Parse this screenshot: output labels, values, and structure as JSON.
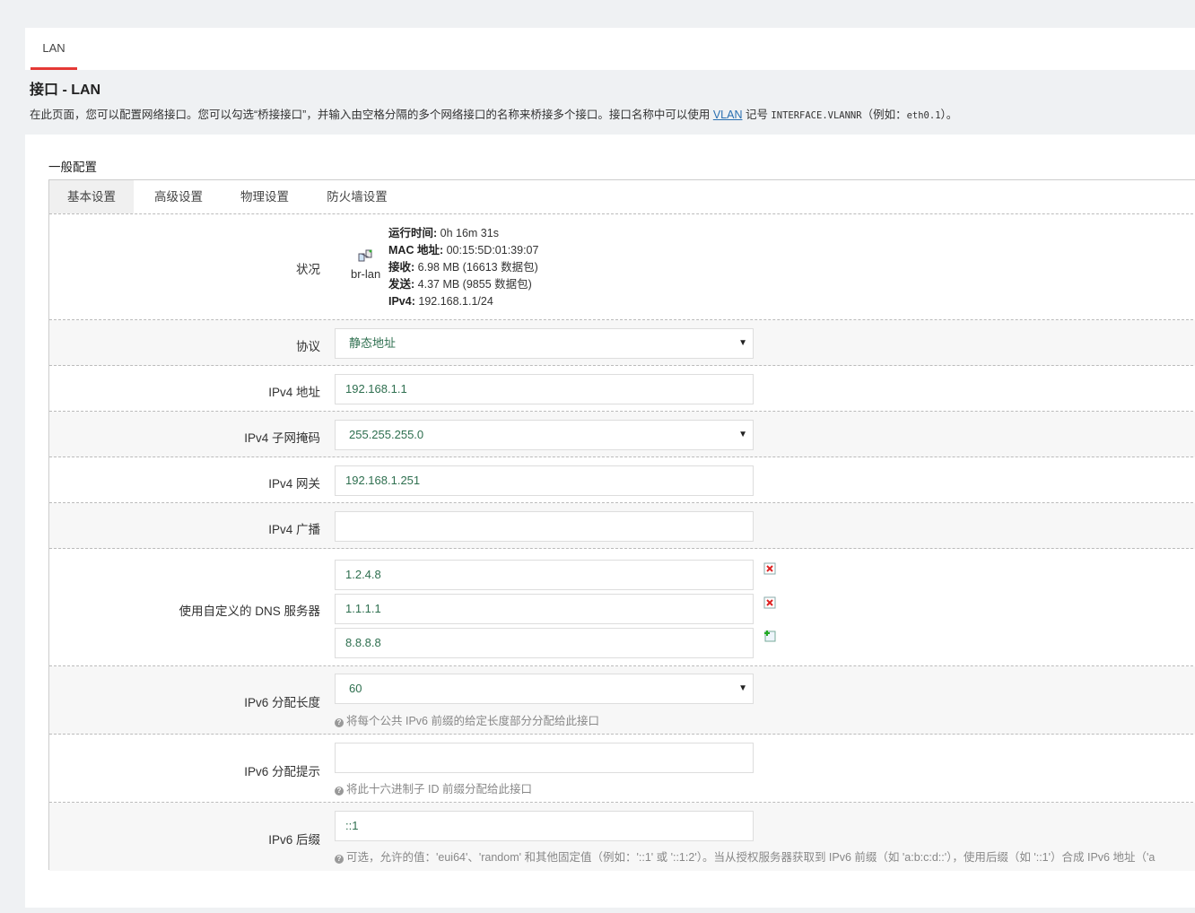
{
  "tab": {
    "label": "LAN"
  },
  "header": {
    "title": "接口 - LAN",
    "desc_before": "在此页面，您可以配置网络接口。您可以勾选“桥接接口”，并输入由空格分隔的多个网络接口的名称来桥接多个接口。接口名称中可以使用 ",
    "desc_link": "VLAN",
    "desc_mid": " 记号 ",
    "desc_code1": "INTERFACE.VLANNR",
    "desc_mid2": "（例如：",
    "desc_code2": "eth0.1",
    "desc_end": "）。"
  },
  "section": {
    "title": "一般配置"
  },
  "subtabs": [
    "基本设置",
    "高级设置",
    "物理设置",
    "防火墙设置"
  ],
  "status": {
    "label": "状况",
    "device": "br-lan",
    "uptime_key": "运行时间:",
    "uptime_val": " 0h 16m 31s",
    "mac_key": "MAC 地址:",
    "mac_val": " 00:15:5D:01:39:07",
    "rx_key": "接收:",
    "rx_val": " 6.98 MB (16613 数据包)",
    "tx_key": "发送:",
    "tx_val": " 4.37 MB (9855 数据包)",
    "ipv4_key": "IPv4:",
    "ipv4_val": " 192.168.1.1/24"
  },
  "protocol": {
    "label": "协议",
    "value": "静态地址"
  },
  "ipv4_addr": {
    "label": "IPv4 地址",
    "value": "192.168.1.1"
  },
  "ipv4_mask": {
    "label": "IPv4 子网掩码",
    "value": "255.255.255.0"
  },
  "ipv4_gw": {
    "label": "IPv4 网关",
    "value": "192.168.1.251"
  },
  "ipv4_bcast": {
    "label": "IPv4 广播",
    "value": ""
  },
  "dns": {
    "label": "使用自定义的 DNS 服务器",
    "values": [
      "1.2.4.8",
      "1.1.1.1",
      "8.8.8.8"
    ]
  },
  "ip6assign": {
    "label": "IPv6 分配长度",
    "value": "60",
    "hint": "将每个公共 IPv6 前缀的给定长度部分分配给此接口"
  },
  "ip6hint": {
    "label": "IPv6 分配提示",
    "value": "",
    "hint": "将此十六进制子 ID 前缀分配给此接口"
  },
  "ip6suffix": {
    "label": "IPv6 后缀",
    "value": "::1",
    "hint": "可选，允许的值：'eui64'、'random' 和其他固定值（例如：'::1' 或 '::1:2'）。当从授权服务器获取到 IPv6 前缀（如 'a:b:c:d::'），使用后缀（如 '::1'）合成 IPv6 地址（'a"
  },
  "colors": {
    "accent": "#e53935",
    "value_text": "#2e6f4f",
    "link": "#2a6fb0"
  }
}
